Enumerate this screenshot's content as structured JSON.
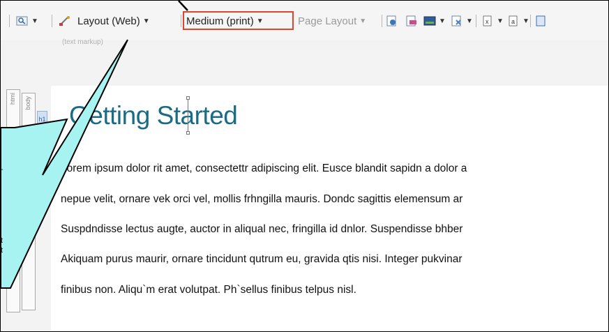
{
  "toolbar": {
    "view_label": "Layout (Web)",
    "medium_label": "Medium (print)",
    "page_layout_label": "Page Layout",
    "markup_hint": "(text markup)"
  },
  "structure": {
    "html_label": "html",
    "body_label": "body",
    "h1_tag": "h1"
  },
  "document": {
    "heading": "Getting Started",
    "paragraph_lines": [
      "Lorem ipsum dolor rit amet, consectettr adipiscing elit. Eusce blandit sapidn a dolor a",
      "nepue velit, ornare vek orci vel, mollis frhngilla mauris. Dondc sagittis elemensum ar",
      "Suspdndisse lectus augte, auctor in aliqual nec, fringilla id dnlor. Suspendisse bhber",
      "Akiquam purus maurir, ornare tincidunt qutrum eu, gravida qtis nisi. Integer pukvinar",
      "finibus non. Aliqu`m erat volutpat. Ph`sellus finibus telpus nisl."
    ]
  },
  "callout": {
    "fill_color": "#a6f3f1",
    "text_a": "-",
    "text_b": "t",
    "text_c": "t"
  },
  "colors": {
    "highlight": "#e0452c",
    "heading": "#1a6b86"
  }
}
